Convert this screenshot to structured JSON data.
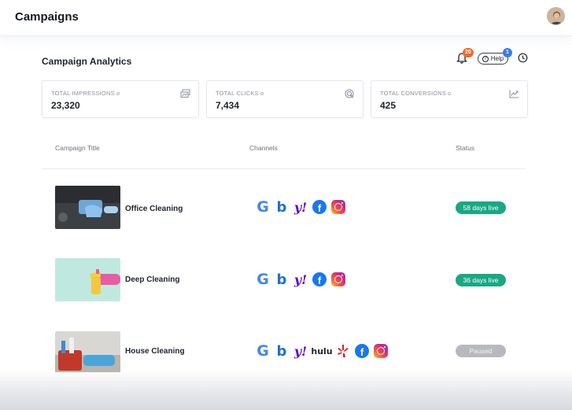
{
  "header": {
    "title": "Campaigns",
    "avatar_icon": "user-avatar"
  },
  "analytics": {
    "title": "Campaign Analytics",
    "notifications_count": "20",
    "help_label": "Help",
    "help_count": "1"
  },
  "stats": [
    {
      "label": "TOTAL IMPRESSIONS",
      "value": "23,320",
      "icon": "impressions-icon"
    },
    {
      "label": "TOTAL CLICKS",
      "value": "7,434",
      "icon": "clicks-icon"
    },
    {
      "label": "TOTAL CONVERSIONS",
      "value": "425",
      "icon": "conversions-icon"
    }
  ],
  "table": {
    "columns": [
      "Campaign Title",
      "Channels",
      "Status"
    ],
    "rows": [
      {
        "title": "Office Cleaning",
        "channels": [
          "google",
          "bing",
          "yahoo",
          "facebook",
          "instagram"
        ],
        "status": "58 days live"
      },
      {
        "title": "Deep Cleaning",
        "channels": [
          "google",
          "bing",
          "yahoo",
          "facebook",
          "instagram"
        ],
        "status": "36 days live"
      },
      {
        "title": "House Cleaning",
        "channels": [
          "google",
          "bing",
          "yahoo",
          "hulu",
          "yelp",
          "facebook",
          "instagram"
        ],
        "status": "Paused"
      }
    ]
  },
  "channel_glyphs": {
    "google": "G",
    "bing": "b",
    "yahoo": "y!",
    "hulu": "hulu",
    "facebook": "f"
  },
  "colors": {
    "live": "#19a884",
    "paused": "#b7b9be",
    "notif_badge": "#f26b2a",
    "help_badge": "#3b7be8"
  }
}
